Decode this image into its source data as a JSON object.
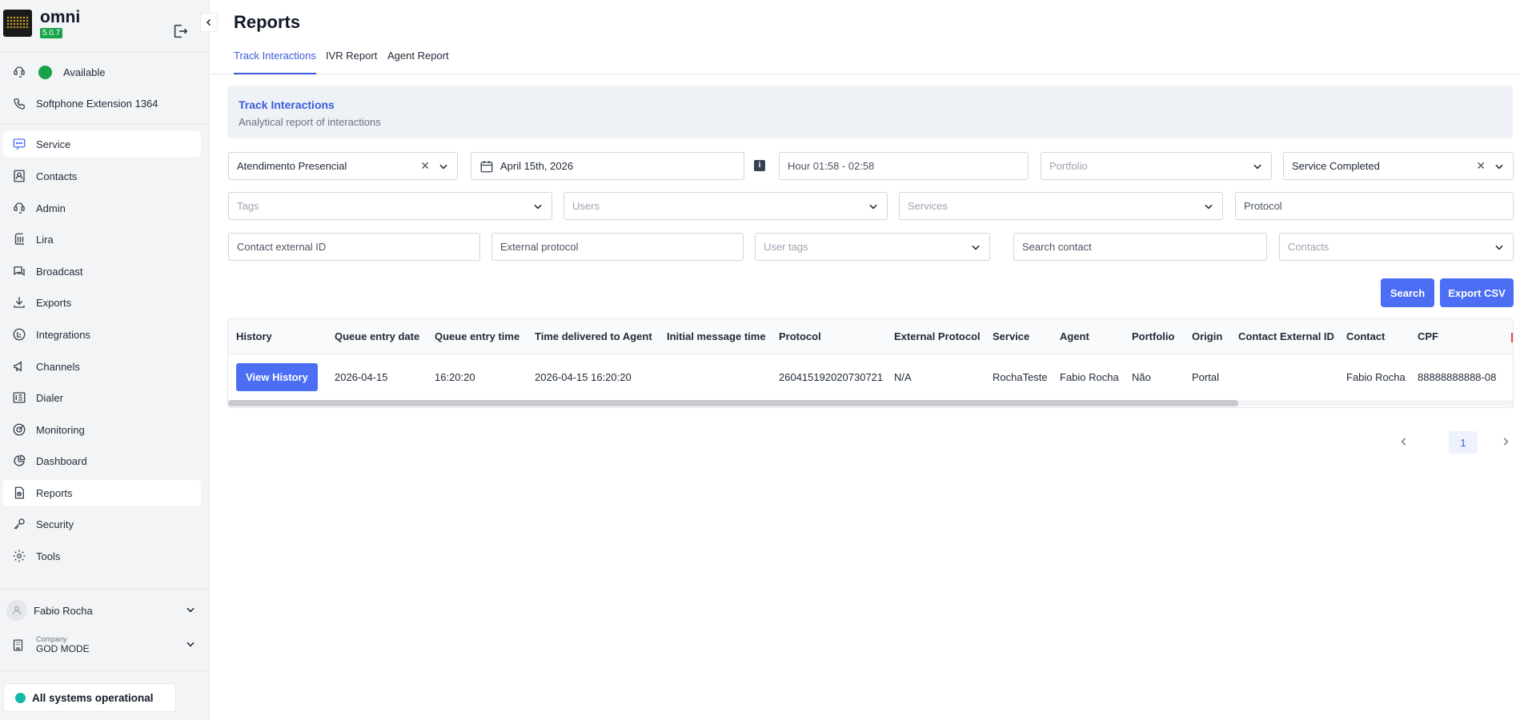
{
  "app": {
    "name": "omni",
    "version": "5.0.7"
  },
  "sidebar": {
    "status_label": "Available",
    "softphone_label": "Softphone Extension 1364",
    "items": [
      {
        "label": "Service",
        "icon": "chat-icon"
      },
      {
        "label": "Contacts",
        "icon": "contacts-icon"
      },
      {
        "label": "Admin",
        "icon": "admin-icon"
      },
      {
        "label": "Lira",
        "icon": "lira-icon"
      },
      {
        "label": "Broadcast",
        "icon": "broadcast-icon"
      },
      {
        "label": "Exports",
        "icon": "download-icon"
      },
      {
        "label": "Integrations",
        "icon": "integrations-icon"
      },
      {
        "label": "Channels",
        "icon": "megaphone-icon"
      },
      {
        "label": "Dialer",
        "icon": "dialer-icon"
      },
      {
        "label": "Monitoring",
        "icon": "target-icon"
      },
      {
        "label": "Dashboard",
        "icon": "pie-chart-icon"
      },
      {
        "label": "Reports",
        "icon": "report-icon"
      },
      {
        "label": "Security",
        "icon": "key-icon"
      },
      {
        "label": "Tools",
        "icon": "gear-icon"
      }
    ],
    "user_name": "Fabio Rocha",
    "company_caption": "Company",
    "company_name": "GOD MODE",
    "system_status": "All systems operational"
  },
  "page": {
    "title": "Reports",
    "tabs": [
      "Track Interactions",
      "IVR Report",
      "Agent Report"
    ],
    "active_tab": "Track Interactions"
  },
  "banner": {
    "title": "Track Interactions",
    "subtitle": "Analytical report of interactions"
  },
  "filters": {
    "service_type": "Atendimento Presencial",
    "date": "April 15th, 2026",
    "hour_range": "Hour 01:58 - 02:58",
    "portfolio_placeholder": "Portfolio",
    "status": "Service Completed",
    "tags_placeholder": "Tags",
    "users_placeholder": "Users",
    "services_placeholder": "Services",
    "protocol_placeholder": "Protocol",
    "contact_external_id_placeholder": "Contact external ID",
    "external_protocol_placeholder": "External protocol",
    "user_tags_placeholder": "User tags",
    "search_contact_placeholder": "Search contact",
    "contacts_placeholder": "Contacts"
  },
  "actions": {
    "search": "Search",
    "export_csv": "Export CSV"
  },
  "table": {
    "columns": [
      "History",
      "Queue entry date",
      "Queue entry time",
      "Time delivered to Agent",
      "Initial message time",
      "Protocol",
      "External Protocol",
      "Service",
      "Agent",
      "Portfolio",
      "Origin",
      "Contact External ID",
      "Contact",
      "CPF"
    ],
    "rows": [
      {
        "history": "View History",
        "queue_entry_date": "2026-04-15",
        "queue_entry_time": "16:20:20",
        "time_delivered": "2026-04-15 16:20:20",
        "initial_message_time": "",
        "protocol": "260415192020730721",
        "external_protocol": "N/A",
        "service": "RochaTeste",
        "agent": "Fabio Rocha",
        "portfolio": "Não",
        "origin": "Portal",
        "contact_external_id": "",
        "contact": "Fabio Rocha",
        "cpf": "88888888888-08"
      }
    ]
  },
  "pagination": {
    "current_page": "1"
  },
  "colors": {
    "accent": "#4c6ef5",
    "status_green": "#16a34a",
    "system_ok": "#14b8a6"
  }
}
